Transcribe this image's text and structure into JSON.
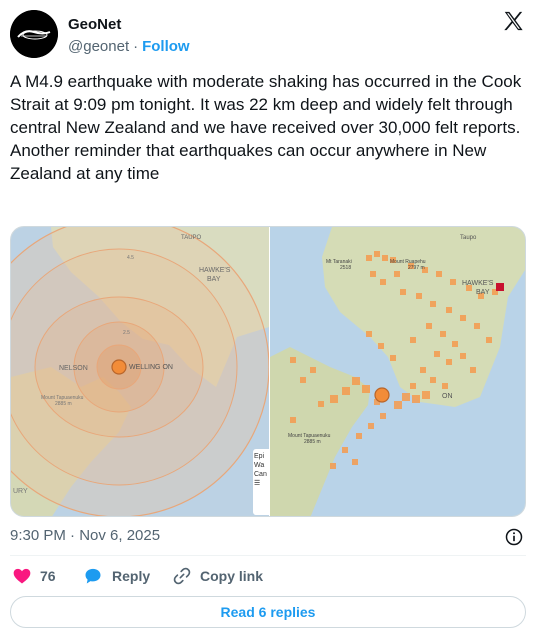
{
  "account": {
    "name": "GeoNet",
    "handle": "@geonet",
    "separator": "·",
    "follow_label": "Follow"
  },
  "icons": {
    "brand": "x-logo-icon",
    "info": "info-icon",
    "like": "heart-icon",
    "reply": "reply-bubble-icon",
    "copy": "link-icon"
  },
  "tweet": {
    "text": "A M4.9 earthquake with moderate shaking has occurred in the Cook Strait at 9:09 pm tonight. It was 22 km deep and widely felt through central New Zealand and we have received over 30,000 felt reports.\nAnother reminder that earthquakes can occur anywhere in New Zealand at any time"
  },
  "media": {
    "left_map": {
      "labels": {
        "taupo": "TAUPO",
        "hawkes_bay": "HAWKE'S\nBAY",
        "nelson": "NELSON",
        "wellington": "WELLING ON",
        "contour_25": "2.5",
        "contour_45": "4.5",
        "mt_tapuaenuku": "Mount Tapuaenuku\n2885 m",
        "bottom_left": "URY"
      },
      "panel_text": [
        "Epi",
        "Wa",
        "",
        "Can",
        "☰"
      ]
    },
    "right_map": {
      "labels": {
        "taupo": "Taupo",
        "mt_taranaki": "Mt Taranaki\n2518",
        "mount_ruapehu": "Mount Ruapehu\n2797 m",
        "hawkes_bay": "HAWKE'S\nBAY",
        "wellington_fragment": "ON",
        "mount_tapuaenuku": "Mount Tapuaenuku\n2885 m"
      }
    },
    "colors": {
      "sea": "#b9d3e8",
      "land": "#d6ddb8",
      "felt_report": "#f59a4d",
      "epicentre": "#f28c38",
      "intensity_ring": "#e8a77a",
      "marker": "#c8102e"
    }
  },
  "meta": {
    "timestamp": "9:30 PM · Nov 6, 2025"
  },
  "actions": {
    "likes": "76",
    "reply_label": "Reply",
    "copy_label": "Copy link"
  },
  "footer": {
    "read_replies": "Read 6 replies"
  }
}
